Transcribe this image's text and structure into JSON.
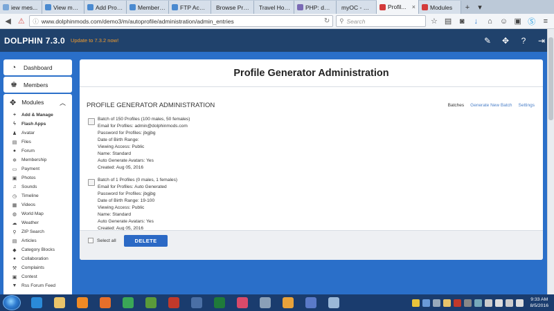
{
  "browser": {
    "tabs": [
      {
        "label": "iew mes...",
        "color": "#7aa7d8"
      },
      {
        "label": "View mes...",
        "color": "#4a8ad0"
      },
      {
        "label": "Add Prod...",
        "color": "#4a8ad0"
      },
      {
        "label": "Member ...",
        "color": "#4a8ad0"
      },
      {
        "label": "FTP Acco...",
        "color": "#4a8ad0"
      },
      {
        "label": "Browse Profiles",
        "color": ""
      },
      {
        "label": "Travel Home",
        "color": ""
      },
      {
        "label": "PHP: deb...",
        "color": "#7a6ab5"
      },
      {
        "label": "myOC - UWI...",
        "color": ""
      },
      {
        "label": "Profil...",
        "color": "#d43b3b"
      },
      {
        "label": "Modules",
        "color": "#d43b3b"
      }
    ],
    "new_tab": "+",
    "tab_list": "▾",
    "url": "www.dolphinmods.com/demo3/m/autoprofile/administration/admin_entries",
    "search_placeholder": "Search"
  },
  "header": {
    "logo": "DOLPHIN 7.3.0",
    "update_link": "Update to 7.3.2 now!"
  },
  "sidebar": {
    "dashboard": "Dashboard",
    "members": "Members",
    "modules": "Modules",
    "module_items": [
      {
        "label": "Add & Manage",
        "icon": "plus-icon",
        "glyph": "+",
        "bold": true
      },
      {
        "label": "Flash Apps",
        "icon": "bolt-icon",
        "glyph": "ϟ",
        "bold": true
      },
      {
        "label": "Avatar",
        "icon": "user-icon",
        "glyph": "♟",
        "bold": false
      },
      {
        "label": "Files",
        "icon": "file-icon",
        "glyph": "▤",
        "bold": false
      },
      {
        "label": "Forum",
        "icon": "comments-icon",
        "glyph": "●",
        "bold": false
      },
      {
        "label": "Membership",
        "icon": "cog-icon",
        "glyph": "✲",
        "bold": false
      },
      {
        "label": "Payment",
        "icon": "card-icon",
        "glyph": "▭",
        "bold": false
      },
      {
        "label": "Photos",
        "icon": "picture-icon",
        "glyph": "▣",
        "bold": false
      },
      {
        "label": "Sounds",
        "icon": "music-icon",
        "glyph": "♫",
        "bold": false
      },
      {
        "label": "Timeline",
        "icon": "clock-icon",
        "glyph": "◷",
        "bold": false
      },
      {
        "label": "Videos",
        "icon": "film-icon",
        "glyph": "▦",
        "bold": false
      },
      {
        "label": "World Map",
        "icon": "globe-icon",
        "glyph": "◍",
        "bold": false
      },
      {
        "label": "Weather",
        "icon": "cloud-icon",
        "glyph": "☁",
        "bold": false
      },
      {
        "label": "ZIP Search",
        "icon": "search-icon",
        "glyph": "⚲",
        "bold": false
      },
      {
        "label": "Articles",
        "icon": "document-icon",
        "glyph": "▤",
        "bold": false
      },
      {
        "label": "Category Blocks",
        "icon": "tag-icon",
        "glyph": "◆",
        "bold": false
      },
      {
        "label": "Collaboration",
        "icon": "group-icon",
        "glyph": "●",
        "bold": false
      },
      {
        "label": "Complaints",
        "icon": "gavel-icon",
        "glyph": "⚒",
        "bold": false
      },
      {
        "label": "Contest",
        "icon": "image-icon",
        "glyph": "▣",
        "bold": false
      },
      {
        "label": "Rss Forum Feed",
        "icon": "filter-icon",
        "glyph": "▼",
        "bold": false
      }
    ]
  },
  "main": {
    "title": "Profile Generator Administration",
    "section_title": "PROFILE GENERATOR ADMINISTRATION",
    "links": {
      "batches": "Batches",
      "generate": "Generate New Batch",
      "settings": "Settings"
    },
    "batches": [
      {
        "lines": [
          "Batch of 150 Profiles (100 males, 50 females)",
          "Email for Profiles: admin@dolphinmods.com",
          "Password for Profiles: jbgjbg",
          "Date of Birth Range:",
          "Viewing Access: Public",
          "Name: Standard",
          "Auto Generate Avatars: Yes",
          "Created: Aug 05, 2016"
        ]
      },
      {
        "lines": [
          "Batch of 1 Profiles (0 males, 1 females)",
          "Email for Profiles: Auto Generated",
          "Password for Profiles: jbgjbg",
          "Date of Birth Range: 19-100",
          "Viewing Access: Public",
          "Name: Standard",
          "Auto Generate Avatars: Yes",
          "Created: Aug 05, 2016"
        ]
      }
    ],
    "select_all": "Select all",
    "delete": "DELETE"
  },
  "taskbar": {
    "apps": [
      {
        "name": "internet-explorer",
        "color": "#2a8ad8"
      },
      {
        "name": "file-explorer",
        "color": "#e9c46a"
      },
      {
        "name": "media-player",
        "color": "#f08a24"
      },
      {
        "name": "firefox",
        "color": "#e76f2a"
      },
      {
        "name": "chrome",
        "color": "#3aa757"
      },
      {
        "name": "frogger-app",
        "color": "#5a9a3a"
      },
      {
        "name": "filezilla",
        "color": "#c0392b"
      },
      {
        "name": "network-app",
        "color": "#4a6fa5"
      },
      {
        "name": "excel",
        "color": "#1f7a3a"
      },
      {
        "name": "eraser-app",
        "color": "#d84a6a"
      },
      {
        "name": "calculator",
        "color": "#8aa0b8"
      },
      {
        "name": "outlook",
        "color": "#e8a23a"
      },
      {
        "name": "language-app",
        "color": "#5a7ac8"
      },
      {
        "name": "paint-app",
        "color": "#9ab8d8"
      }
    ],
    "tray": [
      {
        "name": "shield-tray",
        "color": "#e8c23a"
      },
      {
        "name": "network-tray",
        "color": "#6a9ad8"
      },
      {
        "name": "gear-tray",
        "color": "#9ab"
      },
      {
        "name": "folder-tray",
        "color": "#e9c46a"
      },
      {
        "name": "pdf-tray",
        "color": "#c0392b"
      },
      {
        "name": "camera-tray",
        "color": "#888"
      },
      {
        "name": "cloud-tray",
        "color": "#7ab"
      },
      {
        "name": "wifi-tray",
        "color": "#ccc"
      },
      {
        "name": "flag-tray",
        "color": "#ddd"
      },
      {
        "name": "signal-tray",
        "color": "#ccc"
      },
      {
        "name": "volume-tray",
        "color": "#ddd"
      }
    ],
    "time": "9:33 AM",
    "date": "8/5/2016"
  }
}
